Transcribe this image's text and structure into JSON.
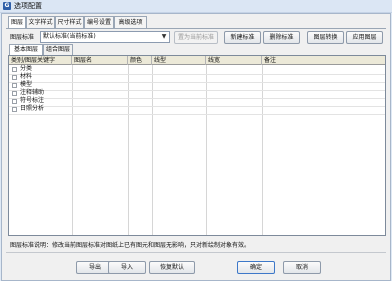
{
  "window": {
    "title": "选项配置",
    "app_icon": "G"
  },
  "tabs": [
    "图层",
    "文字样式",
    "尺寸样式",
    "编号设置",
    "高级选项"
  ],
  "standard": {
    "label": "图层标准",
    "selected": "默认标准(当前标准)",
    "buttons": {
      "set_current": "置为当前标准",
      "new": "新建标准",
      "delete": "删除标准",
      "convert": "图层转换",
      "apply": "应用图层"
    }
  },
  "subtabs": [
    "基本图层",
    "组合图层"
  ],
  "grid": {
    "columns": [
      "类别/图层关键字",
      "图层名",
      "颜色",
      "线型",
      "线宽",
      "备注"
    ],
    "rows": [
      "分类",
      "材料",
      "模型",
      "注释辅助",
      "符号标注",
      "日照分析"
    ]
  },
  "footer": {
    "note": "图层标准说明：修改当前图层标准对图纸上已有图元和图层无影响，只对新绘制对象有效。",
    "buttons": {
      "export": "导出",
      "import": "导入",
      "restore": "恢复默认",
      "ok": "确定",
      "cancel": "取消"
    }
  }
}
